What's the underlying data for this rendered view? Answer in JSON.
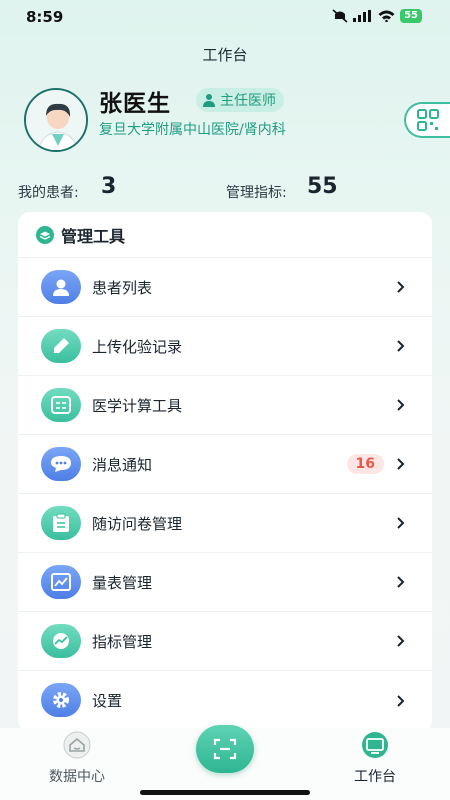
{
  "status_bar": {
    "time": "8:59",
    "battery": "55"
  },
  "header": {
    "title": "工作台"
  },
  "profile": {
    "name": "张医生",
    "title_badge": "主任医师",
    "hospital": "复旦大学附属中山医院/肾内科"
  },
  "stats": {
    "patients_label": "我的患者:",
    "patients_value": "3",
    "indicators_label": "管理指标:",
    "indicators_value": "55"
  },
  "tools": {
    "header": "管理工具",
    "items": [
      {
        "label": "患者列表",
        "icon": "patient-icon",
        "color": "#5b8def"
      },
      {
        "label": "上传化验记录",
        "icon": "dropper-icon",
        "color": "#4cc7a6"
      },
      {
        "label": "医学计算工具",
        "icon": "calculator-icon",
        "color": "#4cc7a6"
      },
      {
        "label": "消息通知",
        "icon": "chat-bubble-icon",
        "color": "#5b8def",
        "badge": "16"
      },
      {
        "label": "随访问卷管理",
        "icon": "clipboard-icon",
        "color": "#4cc7a6"
      },
      {
        "label": "量表管理",
        "icon": "scale-chart-icon",
        "color": "#5b8def"
      },
      {
        "label": "指标管理",
        "icon": "trend-icon",
        "color": "#4cc7a6"
      },
      {
        "label": "设置",
        "icon": "gear-icon",
        "color": "#5b8def"
      }
    ]
  },
  "tab_bar": {
    "data_center": "数据中心",
    "workbench": "工作台",
    "accent": "#2fb592"
  }
}
